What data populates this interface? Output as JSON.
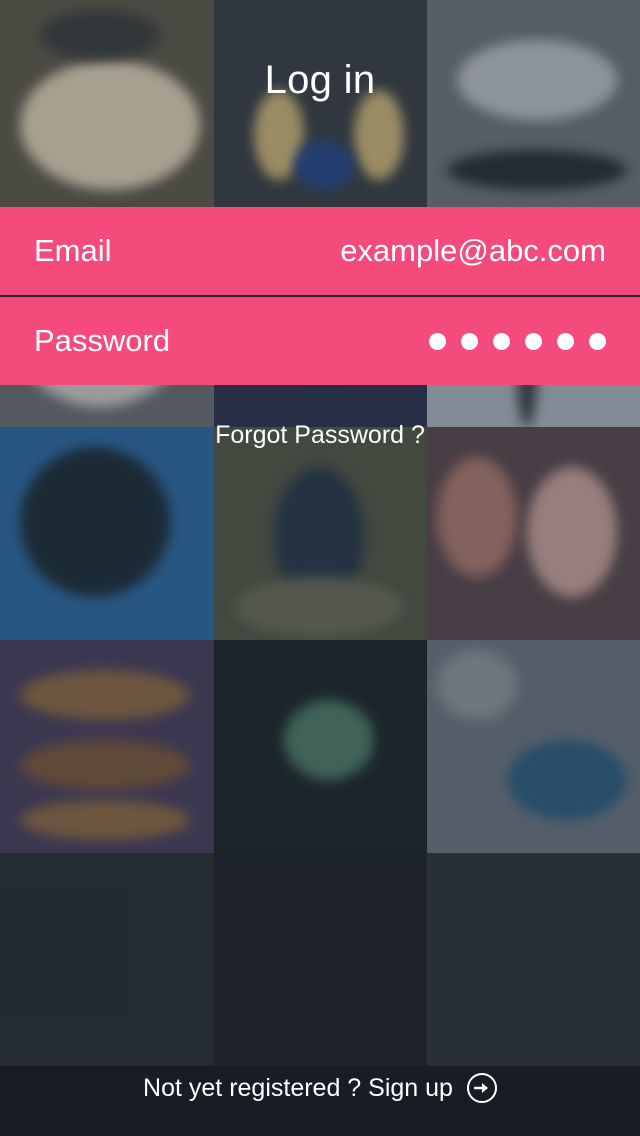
{
  "header": {
    "title": "Log in"
  },
  "form": {
    "email": {
      "label": "Email",
      "value": "example@abc.com"
    },
    "password": {
      "label": "Password",
      "masked_length": 6
    }
  },
  "links": {
    "forgot_password": "Forgot Password ?",
    "signup": "Not yet registered ? Sign up"
  },
  "colors": {
    "accent": "#f54b7c",
    "text": "#ffffff",
    "background": "#1e2530"
  },
  "icons": {
    "signup_arrow": "arrow-right-circle-icon"
  }
}
